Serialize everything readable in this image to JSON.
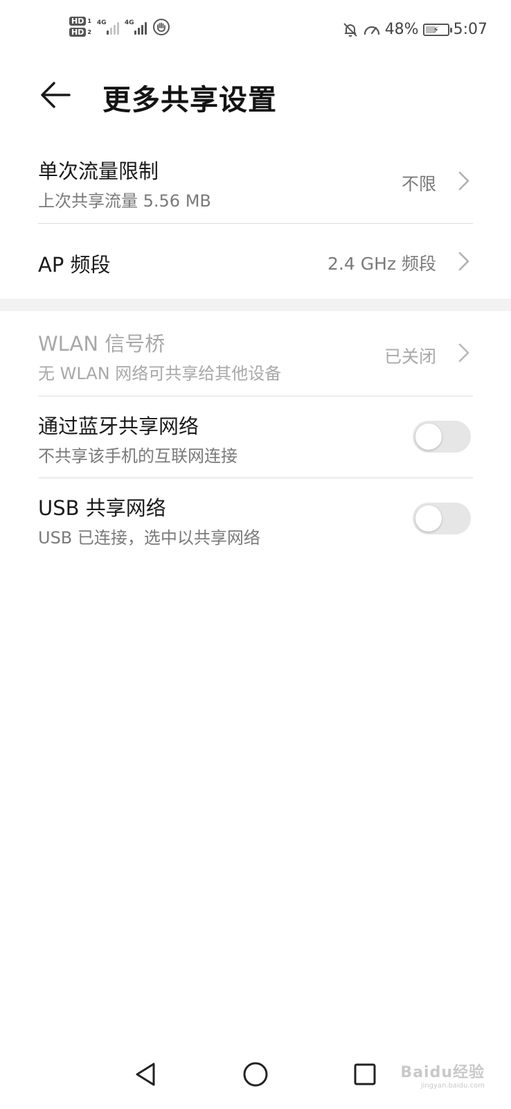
{
  "status_bar": {
    "hd1_label": "HD",
    "hd1_sub": "1",
    "hd2_label": "HD",
    "hd2_sub": "2",
    "sig1_tag": "4G",
    "sig2_tag": "4G",
    "battery_percent": "48%",
    "battery_level": 0.48,
    "time": "5:07",
    "icons": [
      "bell-off-icon",
      "speedometer-icon",
      "battery-charging-icon",
      "hand-icon"
    ]
  },
  "header": {
    "title": "更多共享设置",
    "back_icon": "arrow-left-icon"
  },
  "settings": {
    "data_limit": {
      "title": "单次流量限制",
      "subtitle": "上次共享流量 5.56 MB",
      "value": "不限"
    },
    "ap_band": {
      "title": "AP 频段",
      "value": "2.4 GHz 频段"
    },
    "wlan_bridge": {
      "title": "WLAN 信号桥",
      "subtitle": "无 WLAN 网络可共享给其他设备",
      "value": "已关闭",
      "enabled": false
    },
    "bt_tether": {
      "title": "通过蓝牙共享网络",
      "subtitle": "不共享该手机的互联网连接",
      "on": false
    },
    "usb_tether": {
      "title": "USB 共享网络",
      "subtitle": "USB 已连接，选中以共享网络",
      "on": false
    }
  },
  "navbar": {
    "icons": [
      "back-triangle-icon",
      "home-circle-icon",
      "recents-square-icon"
    ]
  },
  "watermark": {
    "text": "Baidu经验",
    "sub": "jingyan.baidu.com"
  },
  "colors": {
    "background": "#ffffff",
    "primary_text": "#1a1a1a",
    "secondary_text": "#7a7a7a",
    "disabled_text": "#a8a8a8",
    "divider": "#dcdcdc",
    "toggle_off": "#e6e6e6"
  }
}
